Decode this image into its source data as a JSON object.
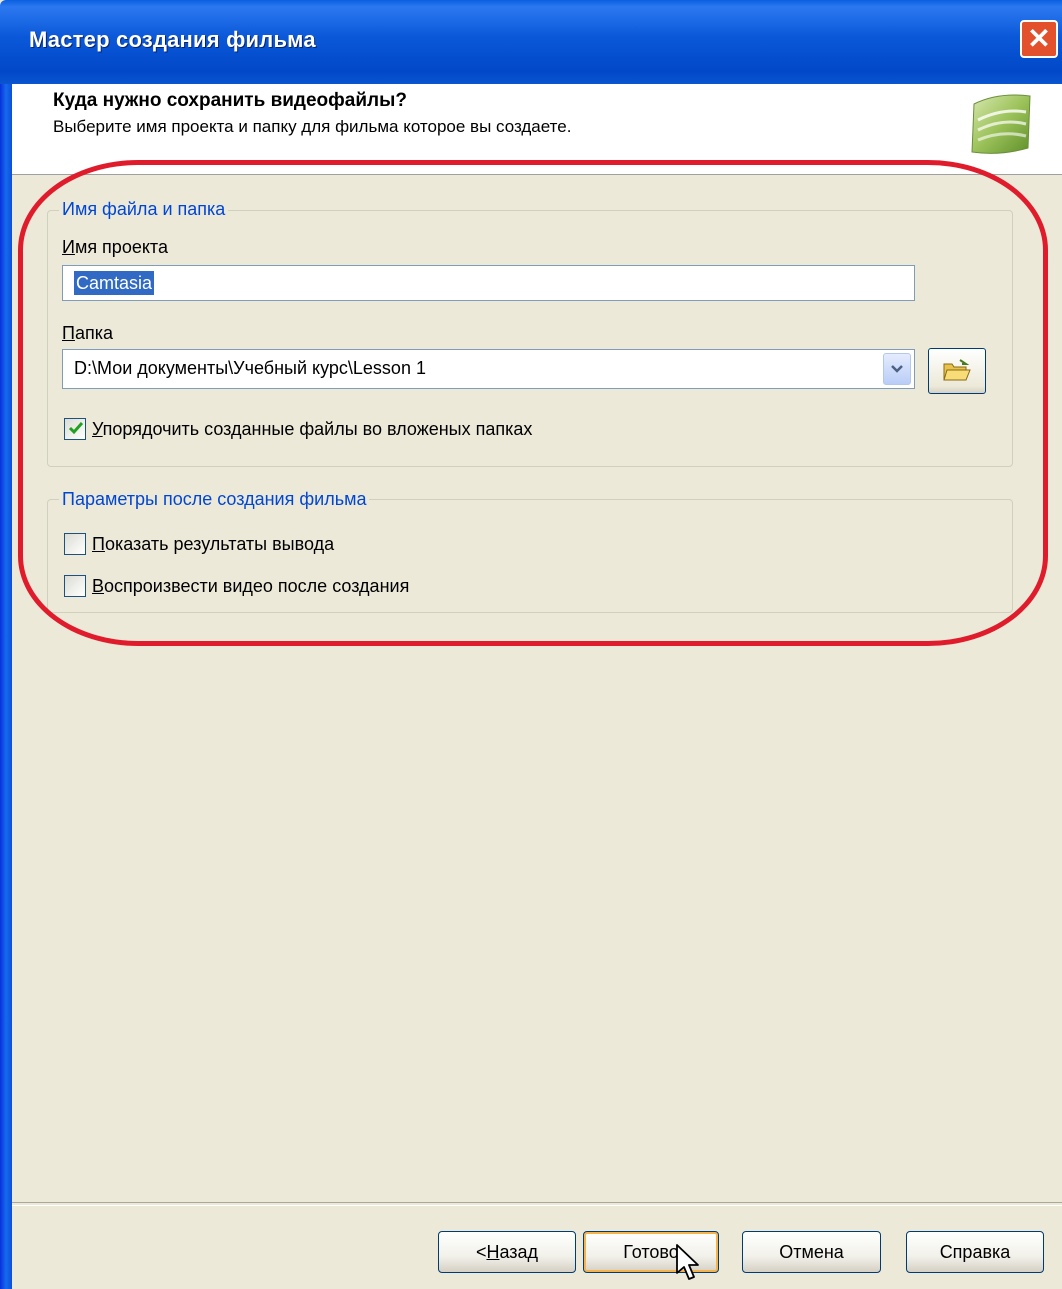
{
  "window": {
    "title": "Мастер создания фильма",
    "close_label": "✕"
  },
  "header": {
    "title": "Куда нужно сохранить видеофайлы?",
    "subtitle": "Выберите имя проекта и папку для фильма которое вы создаете."
  },
  "file_group": {
    "legend": "Имя файла и папка",
    "project_label_mnemonic": "И",
    "project_label_rest": "мя проекта",
    "project_value": "Camtasia",
    "folder_label_mnemonic": "П",
    "folder_label_rest": "апка",
    "folder_value": "D:\\Мои документы\\Учебный курс\\Lesson 1",
    "organize_checked": true,
    "organize_mnemonic": "У",
    "organize_rest": "порядочить созданные файлы во вложеных папках"
  },
  "after_group": {
    "legend": "Параметры после создания фильма",
    "show_results_checked": false,
    "show_results_mnemonic": "П",
    "show_results_rest": "оказать результаты вывода",
    "play_video_checked": false,
    "play_video_mnemonic": "В",
    "play_video_rest": "оспроизвести видео после создания"
  },
  "buttons": {
    "back_prefix": "< ",
    "back_mnemonic": "Н",
    "back_rest": "азад",
    "finish": "Готово",
    "cancel": "Отмена",
    "help": "Справка"
  },
  "colors": {
    "annotation": "#e01c2c",
    "group_legend": "#0046d5",
    "titlebar": "#0a58d8"
  }
}
